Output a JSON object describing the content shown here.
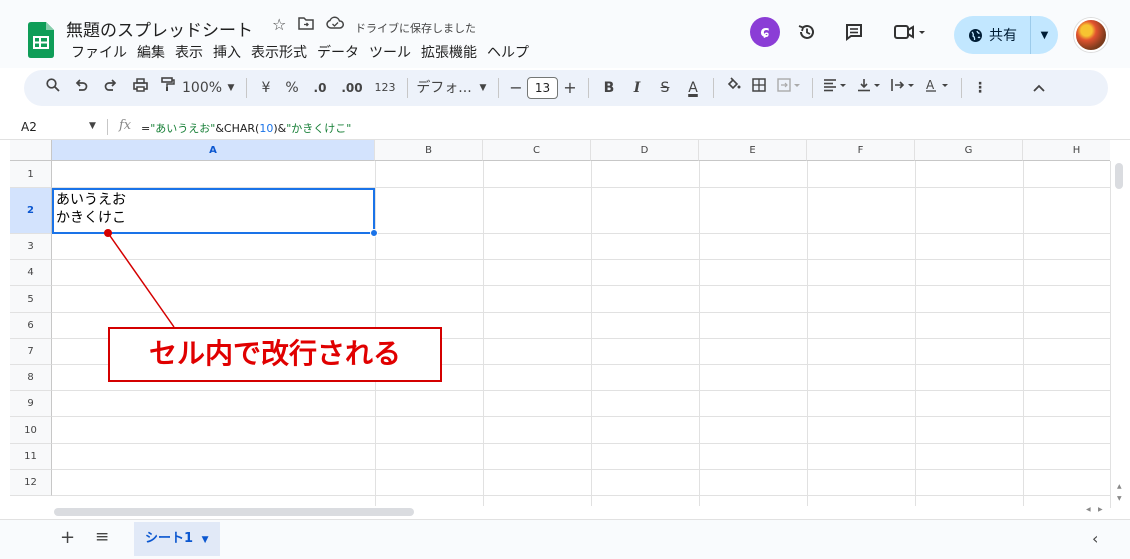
{
  "header": {
    "doc_title": "無題のスプレッドシート",
    "save_status": "ドライブに保存しました",
    "share_label": "共有",
    "menu": [
      "ファイル",
      "編集",
      "表示",
      "挿入",
      "表示形式",
      "データ",
      "ツール",
      "拡張機能",
      "ヘルプ"
    ]
  },
  "toolbar": {
    "zoom": "100%",
    "currency": "¥",
    "percent": "%",
    "dec_decrease": ".0",
    "dec_increase": ".00",
    "number_format": "123",
    "font": "デフォ...",
    "font_size": "13",
    "bold": "B",
    "italic": "I",
    "strike": "S",
    "text_color": "A"
  },
  "formula_bar": {
    "name_box": "A2",
    "fx": "fx",
    "formula_parts": {
      "p1": "=",
      "p2": "\"あいうえお\"",
      "p3": "&CHAR(",
      "p4": "10",
      "p5": ")&",
      "p6": "\"かきくけこ\""
    }
  },
  "grid": {
    "columns": [
      "A",
      "B",
      "C",
      "D",
      "E",
      "F",
      "G",
      "H"
    ],
    "rows": [
      "1",
      "2",
      "3",
      "4",
      "5",
      "6",
      "7",
      "8",
      "9",
      "10",
      "11",
      "12"
    ],
    "selected_cell": "A2",
    "cell_a2": "あいうえお\nかきくけこ"
  },
  "sheets": {
    "tabs": [
      "シート1"
    ]
  },
  "annotation": {
    "text": "セル内で改行される",
    "color": "#e00000"
  },
  "colors": {
    "accent": "#1a73e8",
    "share_bg": "#c2e7ff",
    "toolbar_bg": "#edf2fa",
    "logo_green": "#0f9d58"
  }
}
